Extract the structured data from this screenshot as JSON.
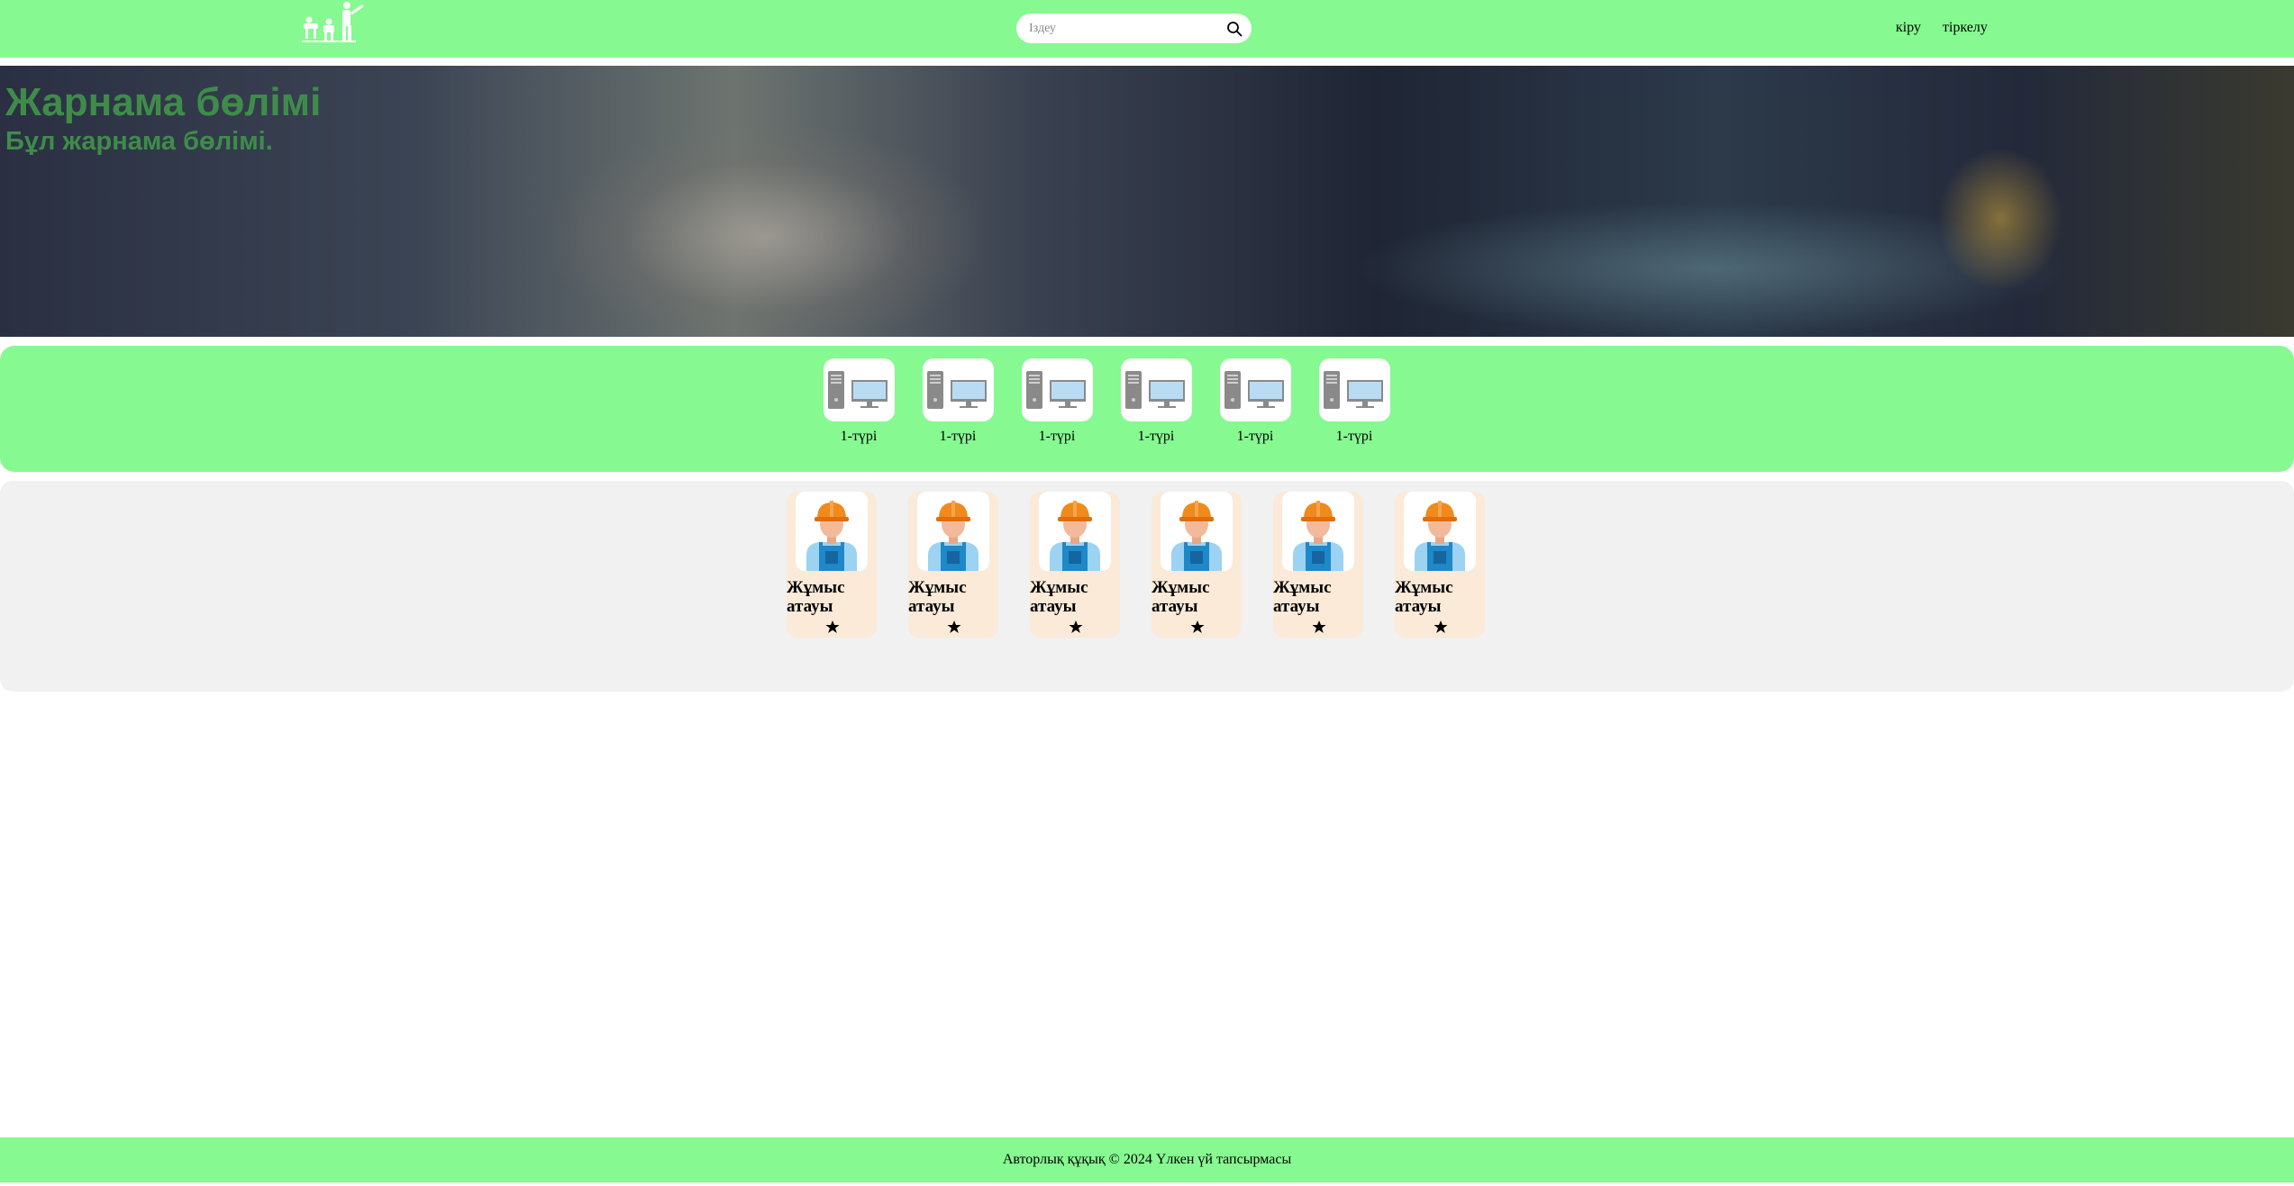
{
  "header": {
    "logo_alt_text": "Jumis Bugi",
    "search_placeholder": "Іздеу",
    "login_label": "кіру",
    "register_label": "тіркелу"
  },
  "banner": {
    "title": "Жарнама бөлімі",
    "subtitle": "Бұл жарнама бөлімі."
  },
  "categories": [
    {
      "label": "1-түрі",
      "icon": "computer-icon"
    },
    {
      "label": "1-түрі",
      "icon": "computer-icon"
    },
    {
      "label": "1-түрі",
      "icon": "computer-icon"
    },
    {
      "label": "1-түрі",
      "icon": "computer-icon"
    },
    {
      "label": "1-түрі",
      "icon": "computer-icon"
    },
    {
      "label": "1-түрі",
      "icon": "computer-icon"
    }
  ],
  "jobs": [
    {
      "title": "Жұмыс атауы",
      "icon": "worker-icon",
      "rating_icon": "star-icon"
    },
    {
      "title": "Жұмыс атауы",
      "icon": "worker-icon",
      "rating_icon": "star-icon"
    },
    {
      "title": "Жұмыс атауы",
      "icon": "worker-icon",
      "rating_icon": "star-icon"
    },
    {
      "title": "Жұмыс атауы",
      "icon": "worker-icon",
      "rating_icon": "star-icon"
    },
    {
      "title": "Жұмыс атауы",
      "icon": "worker-icon",
      "rating_icon": "star-icon"
    },
    {
      "title": "Жұмыс атауы",
      "icon": "worker-icon",
      "rating_icon": "star-icon"
    }
  ],
  "footer": {
    "text": "Авторлық құқық © 2024 Үлкен үй тапсырмасы"
  },
  "colors": {
    "accent_green": "#86f991",
    "jobs_background": "#f1f1f1",
    "job_card": "#faead7",
    "banner_text": "#3f8c4a"
  }
}
